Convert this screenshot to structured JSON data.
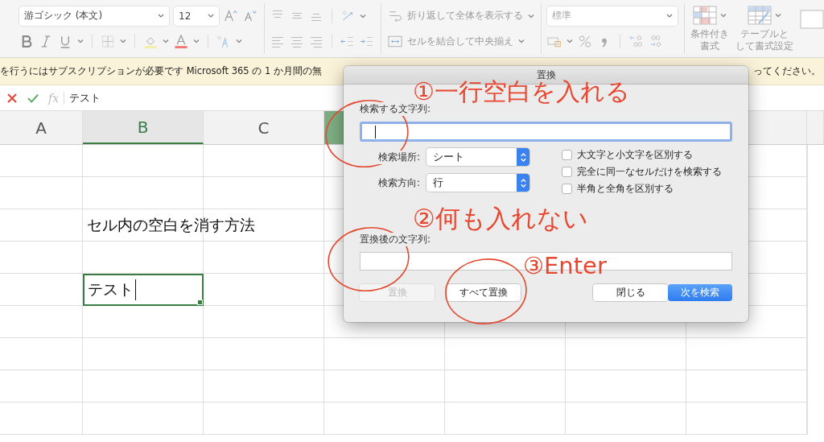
{
  "ribbon": {
    "font_name": "游ゴシック (本文)",
    "font_size": "12",
    "wrap_text": "折り返して全体を表示する",
    "merge_center": "セルを結合して中央揃え",
    "number_format": "標準",
    "conditional_format": [
      "条件付き",
      "書式"
    ],
    "format_as_table": [
      "テーブルと",
      "して書式設定"
    ]
  },
  "banner": {
    "text_left": "を行うにはサブスクリプションが必要です  Microsoft 365 の 1 か月間の無",
    "text_right": "ってください。"
  },
  "formula_bar": {
    "function_label": "fx",
    "value": "テスト"
  },
  "sheet": {
    "columns": [
      {
        "label": "A",
        "active": false
      },
      {
        "label": "B",
        "active": true
      },
      {
        "label": "C",
        "active": false
      },
      {
        "highlighted": true
      }
    ],
    "rows": [
      {
        "kind": "empty"
      },
      {
        "kind": "empty"
      },
      {
        "kind": "text",
        "text": "セル内の空白を消す方法",
        "selected": false
      },
      {
        "kind": "empty"
      },
      {
        "kind": "text",
        "text": "テスト",
        "selected": true
      },
      {
        "kind": "empty"
      },
      {
        "kind": "empty"
      },
      {
        "kind": "empty"
      },
      {
        "kind": "empty"
      }
    ]
  },
  "dialog": {
    "title": "置換",
    "find_label": "検索する文字列:",
    "find_focused": true,
    "search_in_label": "検索場所:",
    "search_in": "シート",
    "direction_label": "検索方向:",
    "direction": "行",
    "options": [
      {
        "label": "大文字と小文字を区別する",
        "checked": false
      },
      {
        "label": "完全に同一なセルだけを検索する",
        "checked": false
      },
      {
        "label": "半角と全角を区別する",
        "checked": false
      }
    ],
    "replace_label": "置換後の文字列:",
    "buttons": [
      {
        "label": "置換",
        "kind": "normal",
        "disabled": true
      },
      {
        "label": "すべて置換",
        "kind": "normal",
        "disabled": false
      },
      {
        "label": "閉じる",
        "kind": "normal",
        "disabled": false
      },
      {
        "label": "次を検索",
        "kind": "primary",
        "disabled": false
      }
    ]
  },
  "annotations": [
    {
      "text": "①一行空白を入れる"
    },
    {
      "text": "②何も入れない"
    },
    {
      "text": "③Enter"
    }
  ]
}
